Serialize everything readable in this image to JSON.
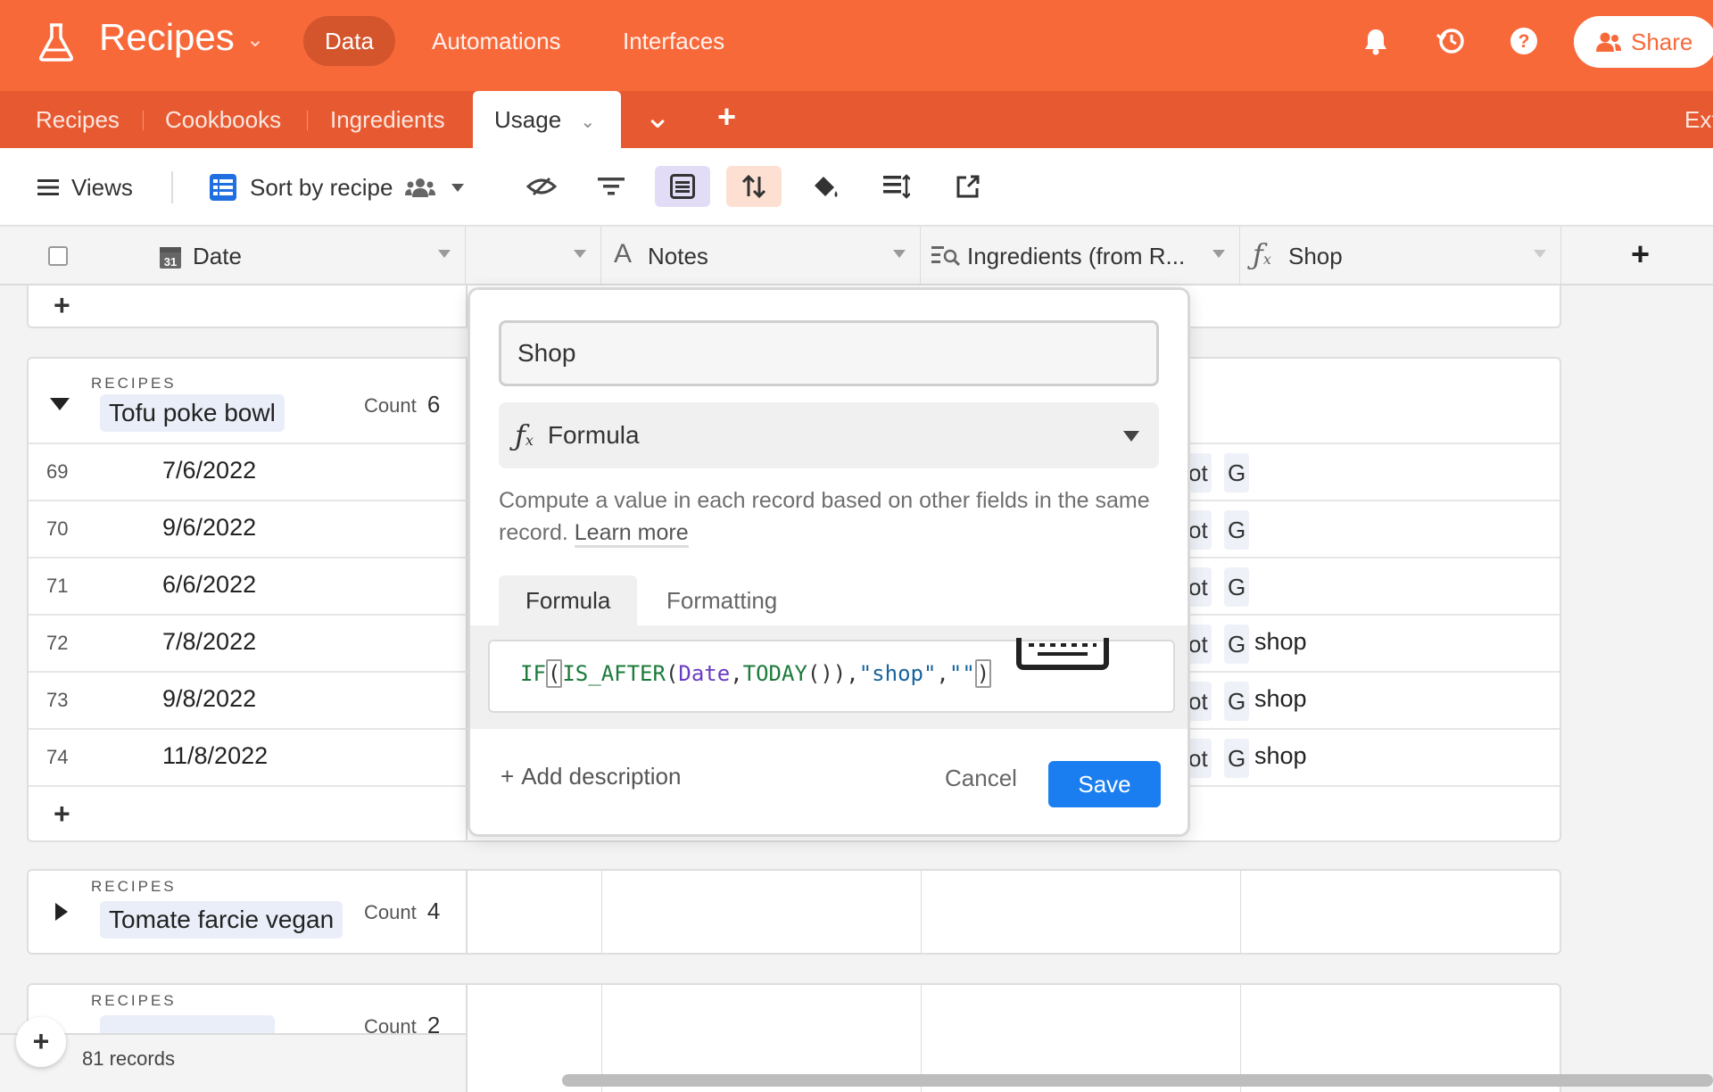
{
  "app": {
    "title": "Recipes",
    "nav": [
      "Data",
      "Automations",
      "Interfaces"
    ],
    "share_label": "Share"
  },
  "tables": {
    "tabs": [
      "Recipes",
      "Cookbooks",
      "Ingredients"
    ],
    "active_tab": "Usage",
    "overflow_label": "Ext"
  },
  "toolbar": {
    "views_label": "Views",
    "view_name": "Sort by recipe"
  },
  "columns": {
    "date": "Date",
    "notes": "Notes",
    "ingredients": "Ingredients (from R...",
    "shop": "Shop"
  },
  "groups": [
    {
      "label": "RECIPES",
      "name": "Tofu poke bowl",
      "count_label": "Count",
      "count": "6",
      "rows": [
        {
          "num": "69",
          "date": "7/6/2022",
          "shop": ""
        },
        {
          "num": "70",
          "date": "9/6/2022",
          "shop": ""
        },
        {
          "num": "71",
          "date": "6/6/2022",
          "shop": ""
        },
        {
          "num": "72",
          "date": "7/8/2022",
          "shop": "shop"
        },
        {
          "num": "73",
          "date": "9/8/2022",
          "shop": "shop"
        },
        {
          "num": "74",
          "date": "11/8/2022",
          "shop": "shop"
        }
      ],
      "chip_a": "ot",
      "chip_b": "G"
    },
    {
      "label": "RECIPES",
      "name": "Tomate farcie vegan",
      "count_label": "Count",
      "count": "4"
    },
    {
      "label": "RECIPES",
      "name": "",
      "count_label": "Count",
      "count": "2"
    }
  ],
  "field_editor": {
    "field_name": "Shop",
    "field_type": "Formula",
    "description": "Compute a value in each record based on other fields in the same record.",
    "learn_more": "Learn more",
    "tabs": [
      "Formula",
      "Formatting"
    ],
    "formula": {
      "fn1": "IF",
      "p1": "(",
      "fn2": "IS_AFTER",
      "p2": "(",
      "arg": "Date",
      "comma1": ",",
      "fn3": "TODAY",
      "p3": "())",
      "comma2": ",",
      "str1": "\"shop\"",
      "comma3": ",",
      "str2": "\"\"",
      "p4": ")"
    },
    "add_description": "Add description",
    "cancel_label": "Cancel",
    "save_label": "Save"
  },
  "footer": {
    "records": "81 records"
  },
  "colors": {
    "brand": "#f8693a",
    "tabbar": "#e75a31",
    "save": "#1a7ef0"
  }
}
